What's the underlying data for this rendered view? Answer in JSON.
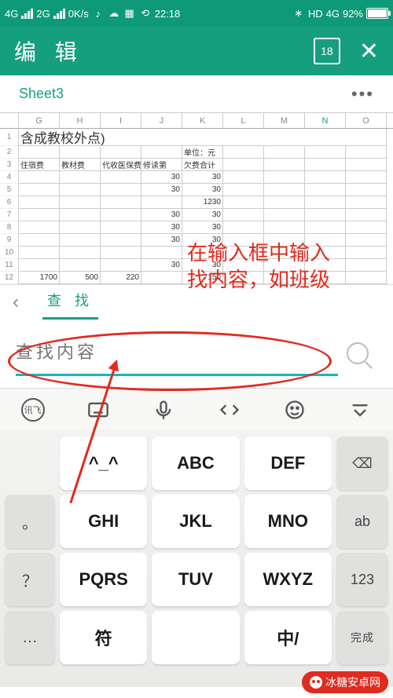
{
  "status": {
    "net1": "4G",
    "net2": "2G",
    "speed": "0K/s",
    "time": "22:18",
    "hd": "HD",
    "net3": "4G",
    "battery_pct": "92%"
  },
  "header": {
    "title": "编 辑",
    "badge": "18"
  },
  "tabs": {
    "sheet": "Sheet3"
  },
  "sheet": {
    "cols": [
      "G",
      "H",
      "I",
      "J",
      "K",
      "L",
      "M",
      "N",
      "O"
    ],
    "row1_text": "含成教校外点)",
    "unit_label": "单位：元",
    "headers": [
      "住宿费",
      "教材费",
      "代收医保费",
      "修读第",
      "欠费合计"
    ],
    "rows": [
      {
        "n": "4",
        "J": "30",
        "K": "30"
      },
      {
        "n": "5",
        "J": "30",
        "K": "30"
      },
      {
        "n": "6",
        "J": "",
        "K": "1230"
      },
      {
        "n": "7",
        "J": "30",
        "K": "30"
      },
      {
        "n": "8",
        "J": "30",
        "K": "30"
      },
      {
        "n": "9",
        "J": "30",
        "K": "30"
      },
      {
        "n": "10",
        "J": "",
        "K": ""
      },
      {
        "n": "11",
        "J": "30",
        "K": "30"
      },
      {
        "n": "12",
        "G": "1700",
        "H": "500",
        "I": "220",
        "K": "7150"
      }
    ]
  },
  "find": {
    "back": "‹",
    "tab_label": "查 找",
    "placeholder": "查找内容"
  },
  "keyboard": {
    "toolbar": [
      "logo",
      "keyboard",
      "mic",
      "code",
      "emoji",
      "dropdown"
    ],
    "keys": {
      "r1": [
        "^_^",
        "ABC",
        "DEF",
        "⌫"
      ],
      "r2": [
        "。",
        "GHI",
        "JKL",
        "MNO",
        "ab"
      ],
      "r3": [
        "？",
        "PQRS",
        "TUV",
        "WXYZ",
        "123"
      ],
      "r4": [
        "…",
        "符",
        "",
        "中/",
        "完成"
      ]
    },
    "logo_text": "讯飞"
  },
  "annotation": {
    "line1": "在输入框中输入",
    "line2": "找内容，如班级"
  },
  "watermark": "冰糖安卓网"
}
